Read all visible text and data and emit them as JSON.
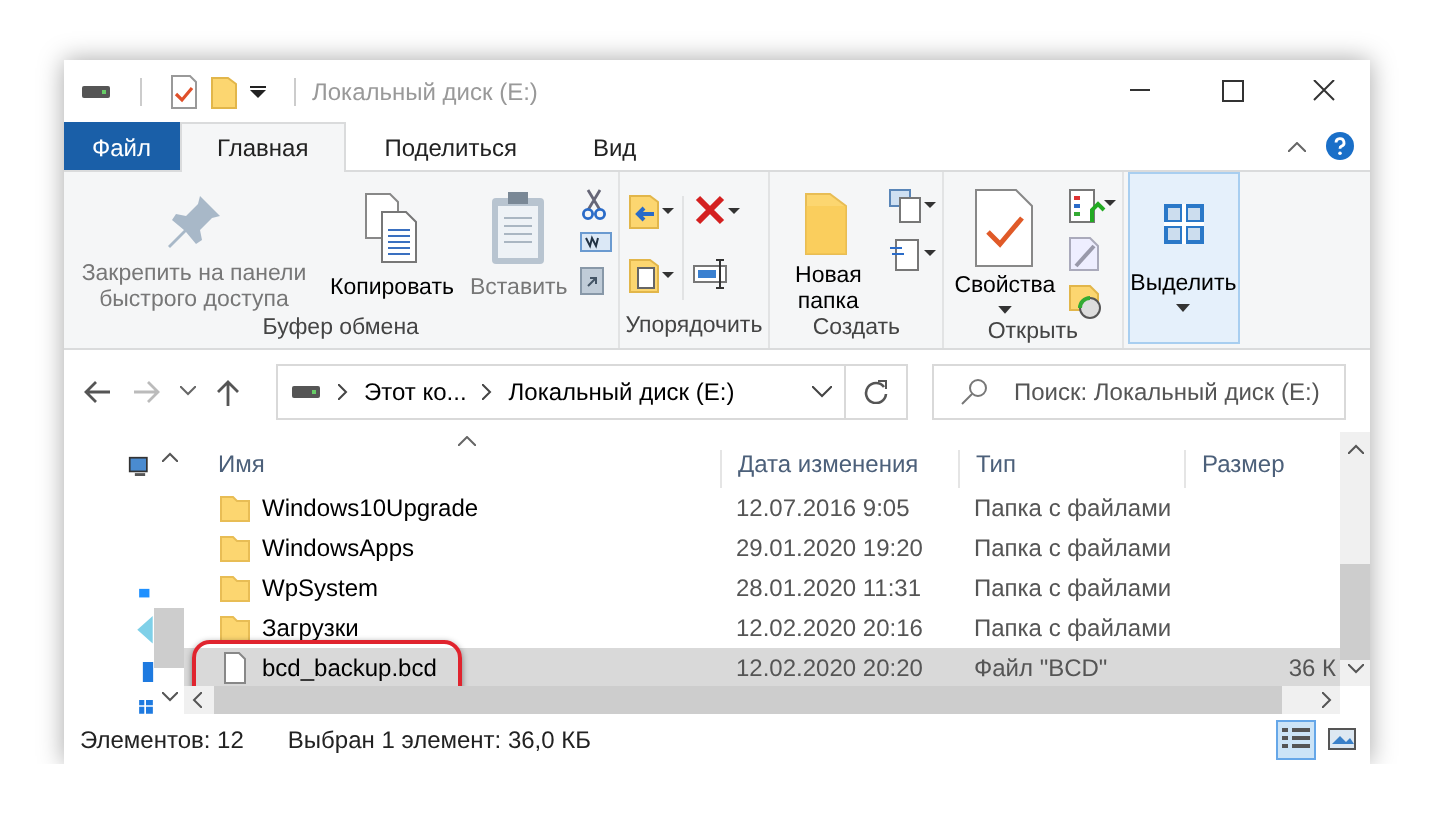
{
  "window": {
    "title": "Локальный диск (E:)"
  },
  "ribbon_tabs": [
    {
      "label": "Файл",
      "kind": "file",
      "selected": false
    },
    {
      "label": "Главная",
      "kind": "tab",
      "selected": true
    },
    {
      "label": "Поделиться",
      "kind": "tab",
      "selected": false
    },
    {
      "label": "Вид",
      "kind": "tab",
      "selected": false
    }
  ],
  "ribbon_groups": [
    {
      "label": "Буфер обмена",
      "buttons": [
        {
          "label": "Закрепить на панели быстрого доступа",
          "disabled": true,
          "dropdown": false,
          "highlighted": false
        },
        {
          "label": "Копировать",
          "disabled": false,
          "dropdown": false,
          "highlighted": false
        },
        {
          "label": "Вставить",
          "disabled": true,
          "dropdown": false,
          "highlighted": false
        }
      ]
    },
    {
      "label": "Упорядочить"
    },
    {
      "label": "Создать",
      "buttons": [
        {
          "label": "Новая папка",
          "disabled": false,
          "dropdown": false,
          "highlighted": false
        }
      ]
    },
    {
      "label": "Открыть",
      "buttons": [
        {
          "label": "Свойства",
          "disabled": false,
          "dropdown": true,
          "highlighted": false
        }
      ]
    },
    {
      "buttons": [
        {
          "label": "Выделить",
          "disabled": false,
          "dropdown": true,
          "highlighted": true
        }
      ]
    }
  ],
  "address_bar": {
    "path": [
      "Этот ко...",
      "Локальный диск (E:)"
    ]
  },
  "search": {
    "placeholder": "Поиск: Локальный диск (E:)"
  },
  "table": {
    "columns": [
      "Имя",
      "Дата изменения",
      "Тип",
      "Размер"
    ],
    "rows": [
      {
        "kind": "folder",
        "name": "Windows10Upgrade",
        "date": "12.07.2016 9:05",
        "type": "Папка с файлами",
        "selected": false
      },
      {
        "kind": "folder",
        "name": "WindowsApps",
        "date": "29.01.2020 19:20",
        "type": "Папка с файлами",
        "selected": false
      },
      {
        "kind": "folder",
        "name": "WpSystem",
        "date": "28.01.2020 11:31",
        "type": "Папка с файлами",
        "selected": false
      },
      {
        "kind": "folder",
        "name": "Загрузки",
        "date": "12.02.2020 20:16",
        "type": "Папка с файлами",
        "selected": false
      },
      {
        "kind": "file",
        "name": "bcd_backup.bcd",
        "date": "12.02.2020 20:20",
        "type": "Файл \"BCD\"",
        "size": "36 К",
        "selected": true
      }
    ]
  },
  "status_bar": {
    "items": [
      "Элементов: 12",
      "Выбран 1 элемент: 36,0 КБ"
    ],
    "views": [
      {
        "kind": "details",
        "selected": true
      },
      {
        "kind": "large-icons",
        "selected": false
      }
    ]
  }
}
